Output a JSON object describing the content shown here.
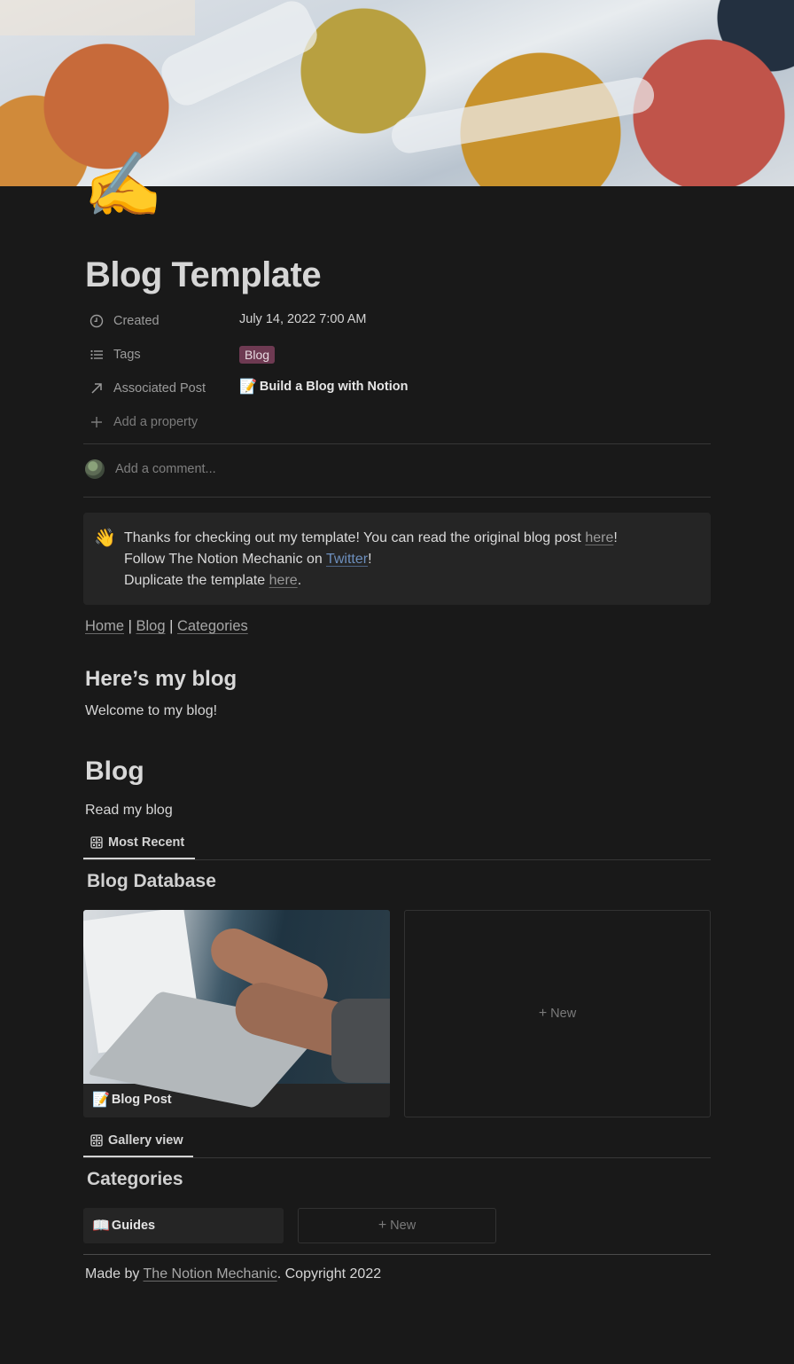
{
  "page": {
    "icon": "✍️",
    "title": "Blog Template"
  },
  "properties": [
    {
      "icon": "clock-icon",
      "name": "Created",
      "value": "July 14, 2022 7:00 AM"
    },
    {
      "icon": "list-icon",
      "name": "Tags",
      "value": "Blog"
    },
    {
      "icon": "arrow-up-right-icon",
      "name": "Associated Post",
      "emoji": "📝",
      "value": "Build a Blog with Notion"
    },
    {
      "icon": "plus-icon",
      "name": "Add a property"
    }
  ],
  "tag_color": "#6e3a52",
  "comment": {
    "placeholder": "Add a comment..."
  },
  "callout": {
    "emoji": "👋",
    "line1_pre": "Thanks for checking out my template! You can read the original blog post ",
    "line1_link": "here",
    "line1_post": "!",
    "line2_pre": "Follow The Notion Mechanic on ",
    "line2_link": "Twitter",
    "line2_post": "!",
    "line3_pre": "Duplicate the template ",
    "line3_link": "here",
    "line3_post": "."
  },
  "nav": {
    "home": "Home",
    "sep1": " | ",
    "blog": "Blog",
    "sep2": " | ",
    "categories": "Categories"
  },
  "intro": {
    "heading": "Here’s my blog",
    "text": "Welcome to my blog!"
  },
  "blog_section": {
    "heading": "Blog",
    "text": "Read my blog",
    "view_tab": "Most Recent",
    "database_title": "Blog Database",
    "cards": [
      {
        "emoji": "📝",
        "title": "Blog Post"
      }
    ],
    "new_label": "New"
  },
  "categories_section": {
    "view_tab": "Gallery view",
    "database_title": "Categories",
    "cards": [
      {
        "emoji": "📖",
        "title": "Guides"
      }
    ],
    "new_label": "New"
  },
  "footer": {
    "pre": "Made by ",
    "link": "The Notion Mechanic",
    "post": ". Copyright 2022"
  }
}
